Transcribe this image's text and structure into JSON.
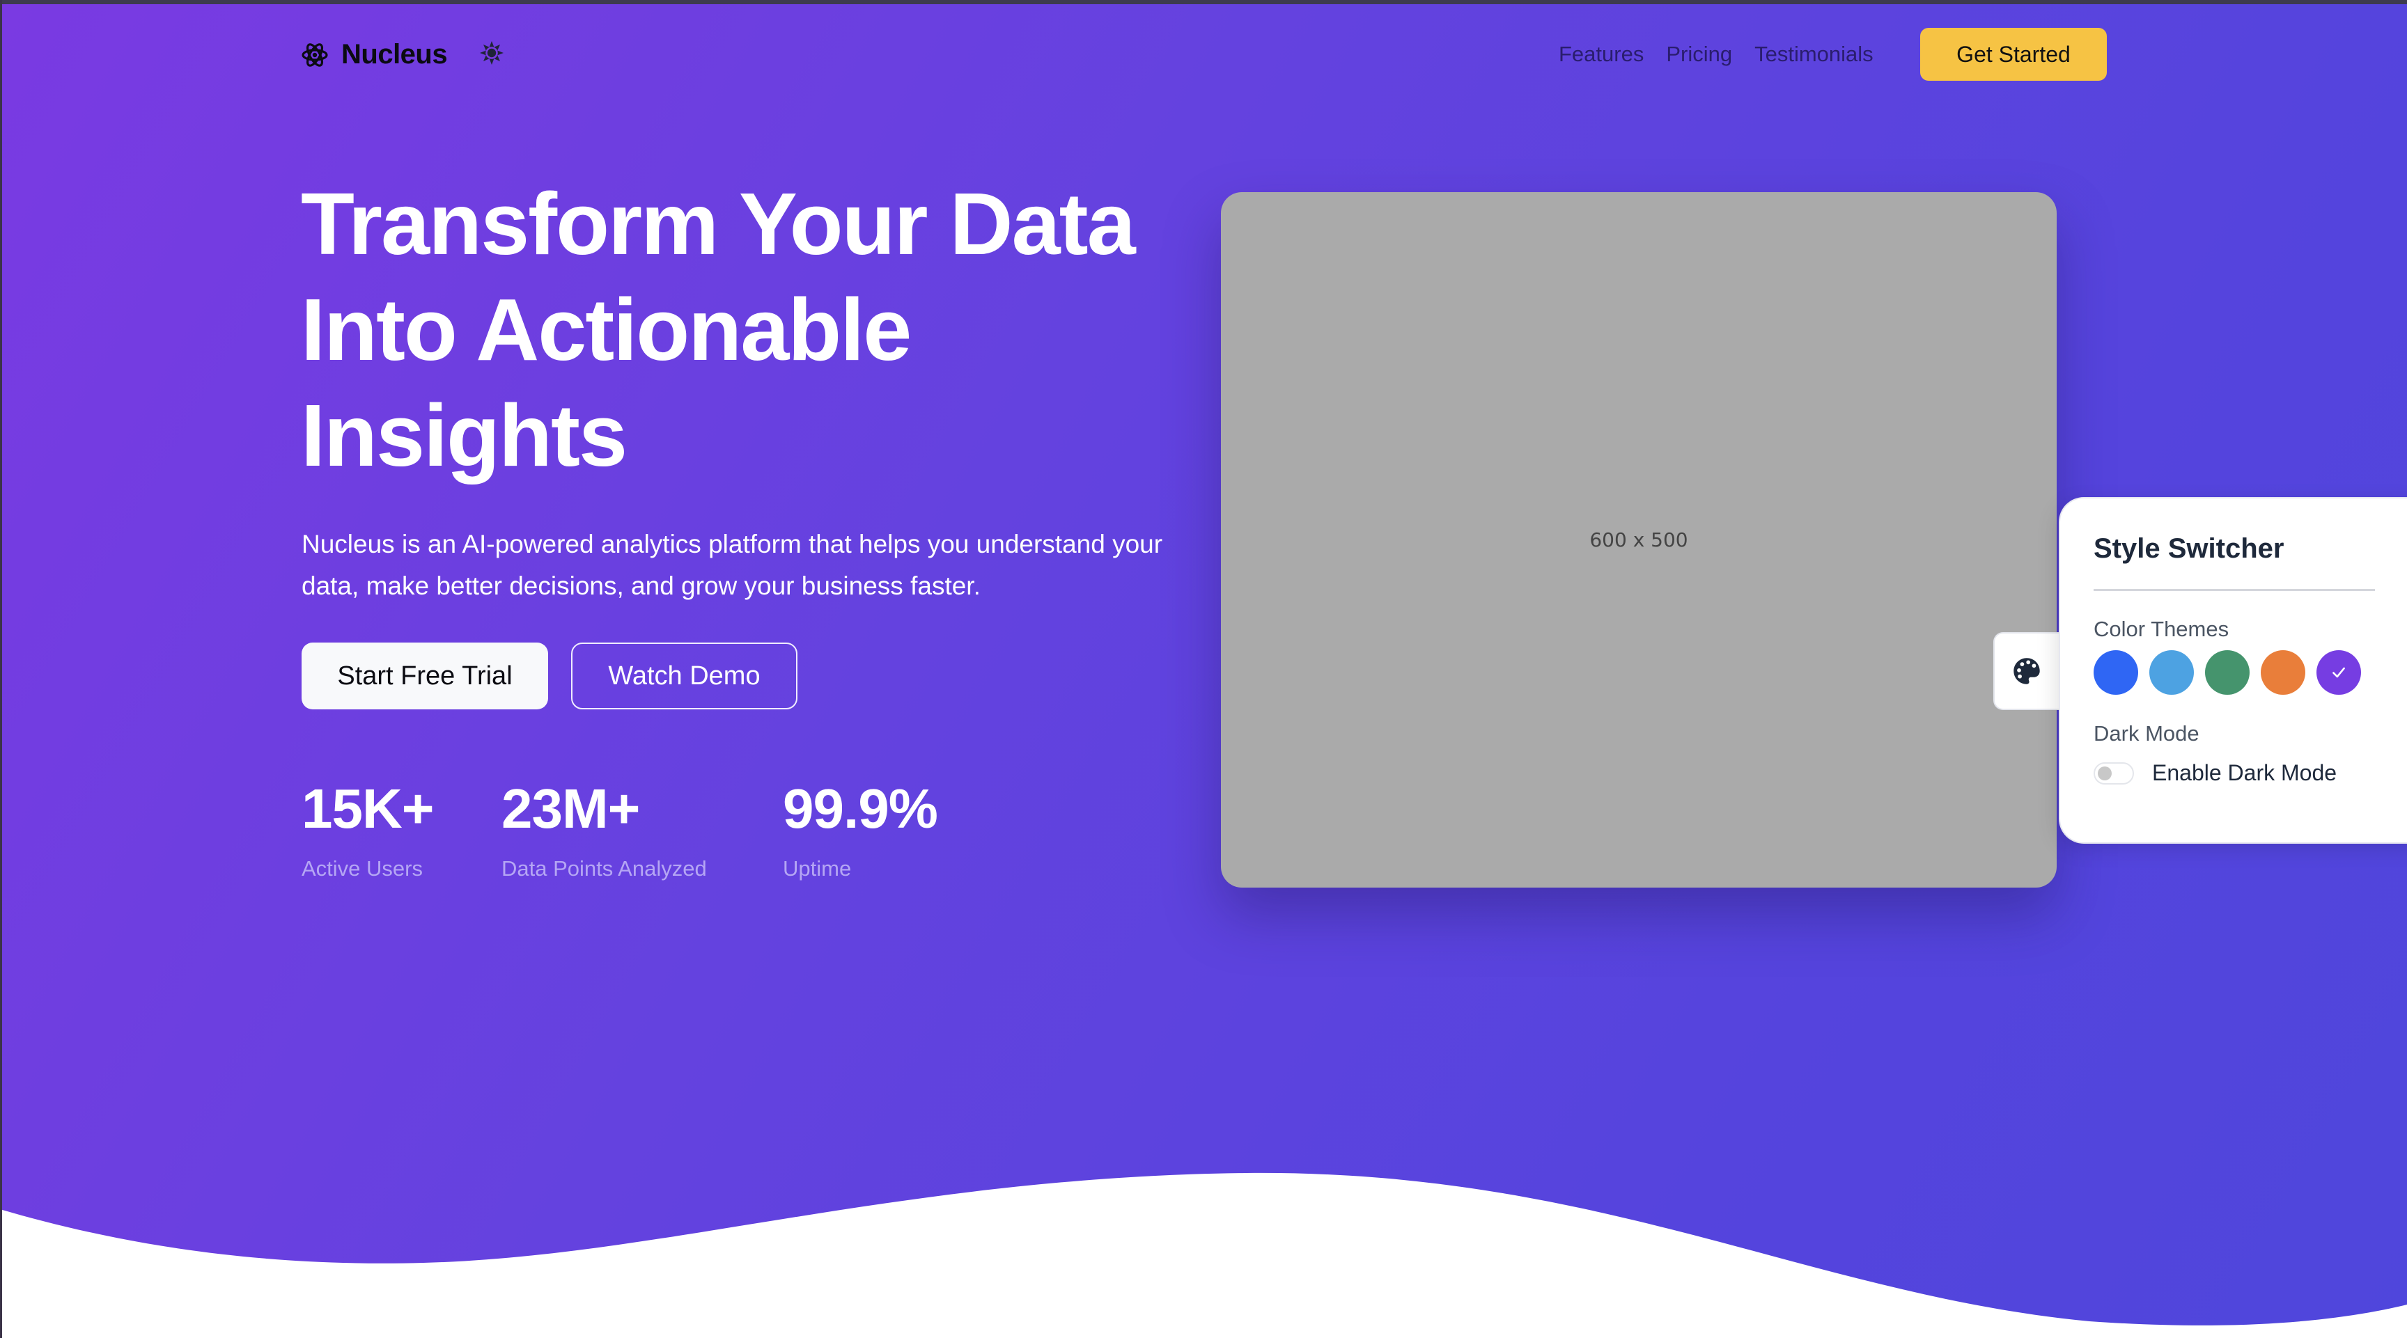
{
  "brand": {
    "name": "Nucleus",
    "logo_icon": "atom-icon",
    "theme_toggle_icon": "sun-icon"
  },
  "nav": {
    "links": [
      "Features",
      "Pricing",
      "Testimonials"
    ],
    "cta_label": "Get Started"
  },
  "hero": {
    "headline_lines": [
      "Transform Your Data",
      "Into Actionable",
      "Insights"
    ],
    "lead": "Nucleus is an AI-powered analytics platform that helps you understand your data, make better decisions, and grow your business faster.",
    "primary_button": "Start Free Trial",
    "secondary_button": "Watch Demo",
    "stats": [
      {
        "value": "15K+",
        "label": "Active Users"
      },
      {
        "value": "23M+",
        "label": "Data Points Analyzed"
      },
      {
        "value": "99.9%",
        "label": "Uptime"
      }
    ],
    "image_placeholder": "600 x 500"
  },
  "style_switcher": {
    "toggle_icon": "palette-icon",
    "title": "Style Switcher",
    "color_themes_label": "Color Themes",
    "themes": [
      {
        "name": "blue",
        "color": "#2f66f4",
        "selected": false
      },
      {
        "name": "light-blue",
        "color": "#4da2e2",
        "selected": false
      },
      {
        "name": "green",
        "color": "#45946d",
        "selected": false
      },
      {
        "name": "orange",
        "color": "#e97e3a",
        "selected": false
      },
      {
        "name": "purple",
        "color": "#763de2",
        "selected": true
      }
    ],
    "selected_mark": "✓",
    "dark_mode_label": "Dark Mode",
    "dark_mode_toggle_label": "Enable Dark Mode",
    "dark_mode_enabled": false
  },
  "colors": {
    "gradient_start": "#7a3ae2",
    "gradient_end": "#4f46dc",
    "cta": "#f6c344",
    "placeholder": "#aaaaaa"
  }
}
